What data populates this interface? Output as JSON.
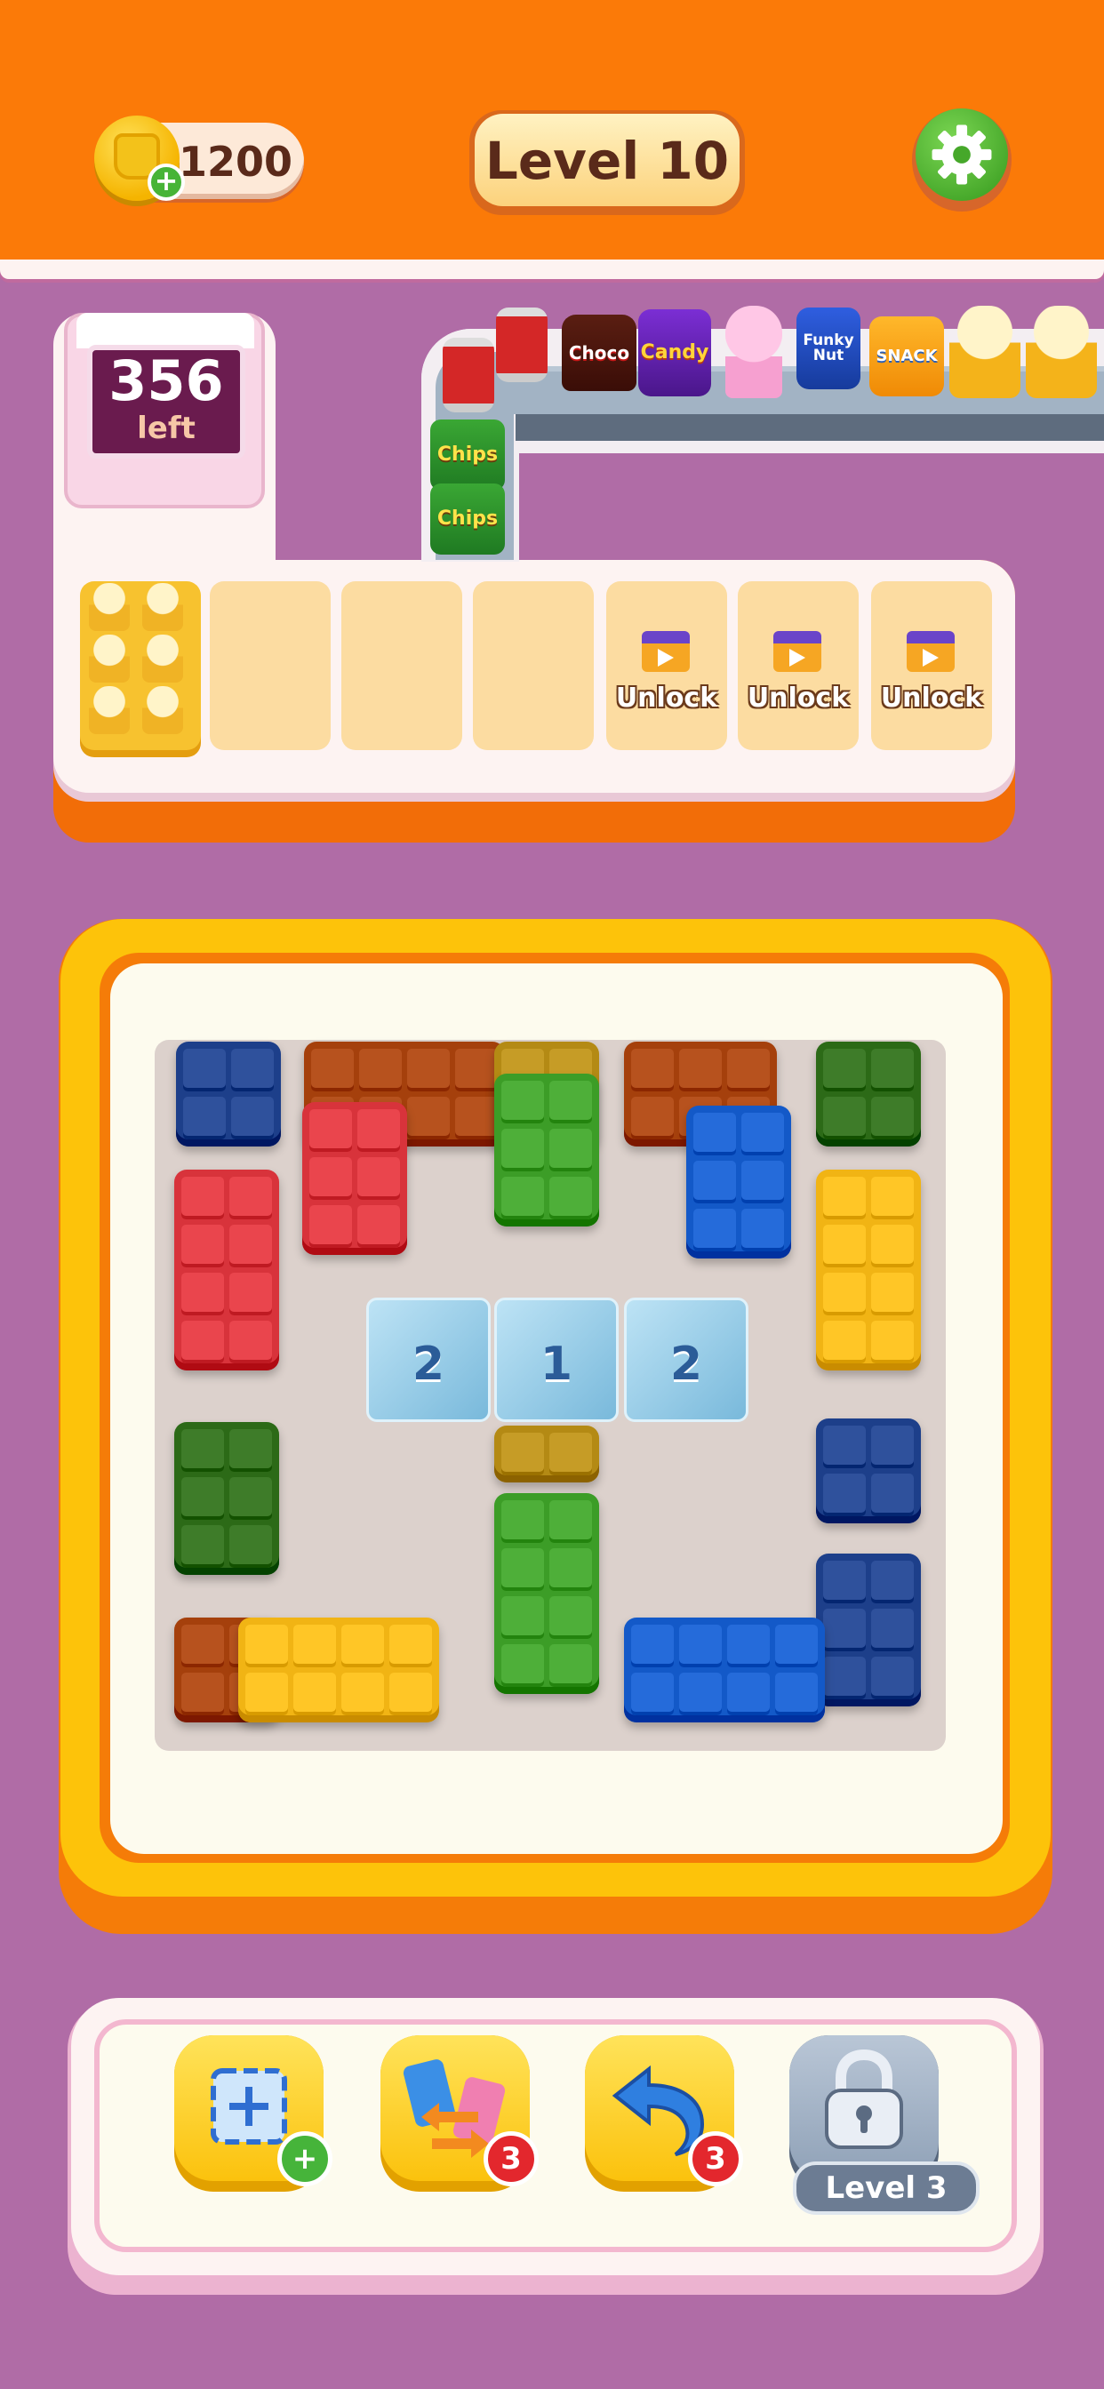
{
  "header": {
    "coins": "1200",
    "level_label": "Level 10",
    "settings_icon": "gear-icon",
    "coin_icon": "coin-bag-icon",
    "colors": {
      "header_bg": "#fb7a08",
      "page_bg": "#b06ca6",
      "settings_green": "#46a82a"
    }
  },
  "counter": {
    "remaining": "356",
    "label": "left"
  },
  "conveyor": {
    "products_horizontal": [
      {
        "kind": "can",
        "label": ""
      },
      {
        "kind": "bag-choco",
        "label": "Choco"
      },
      {
        "kind": "candy",
        "label": "Candy"
      },
      {
        "kind": "cone",
        "label": ""
      },
      {
        "kind": "funky",
        "label": "Funky Nut"
      },
      {
        "kind": "snack",
        "label": "SNACK"
      },
      {
        "kind": "popcorn",
        "label": ""
      },
      {
        "kind": "popcorn",
        "label": ""
      }
    ],
    "products_vertical": [
      {
        "kind": "can",
        "label": ""
      },
      {
        "kind": "chips",
        "label": "Chips"
      },
      {
        "kind": "chips",
        "label": "Chips"
      }
    ]
  },
  "slots": [
    {
      "state": "filled",
      "item": "popcorn-cups",
      "count": 6
    },
    {
      "state": "empty"
    },
    {
      "state": "empty"
    },
    {
      "state": "empty"
    },
    {
      "state": "locked",
      "label": "Unlock",
      "icon": "video-ad-icon"
    },
    {
      "state": "locked",
      "label": "Unlock",
      "icon": "video-ad-icon"
    },
    {
      "state": "locked",
      "label": "Unlock",
      "icon": "video-ad-icon"
    }
  ],
  "board": {
    "colors": {
      "navy": "#1d3f8a",
      "red": "#d8333b",
      "green": "#3c9d27",
      "darkgreen": "#2c6a17",
      "yellow": "#f1b414",
      "blue": "#1359c8",
      "brown": "#a5400c",
      "olive": "#b48a14"
    },
    "ice_tiles": [
      "2",
      "1",
      "2"
    ]
  },
  "boosters": [
    {
      "name": "add-slot",
      "icon": "add-slot-icon",
      "badge": "+"
    },
    {
      "name": "swap",
      "icon": "swap-icon",
      "badge": "3"
    },
    {
      "name": "undo",
      "icon": "undo-icon",
      "badge": "3"
    },
    {
      "name": "locked",
      "icon": "padlock-icon",
      "label": "Level 3"
    }
  ]
}
